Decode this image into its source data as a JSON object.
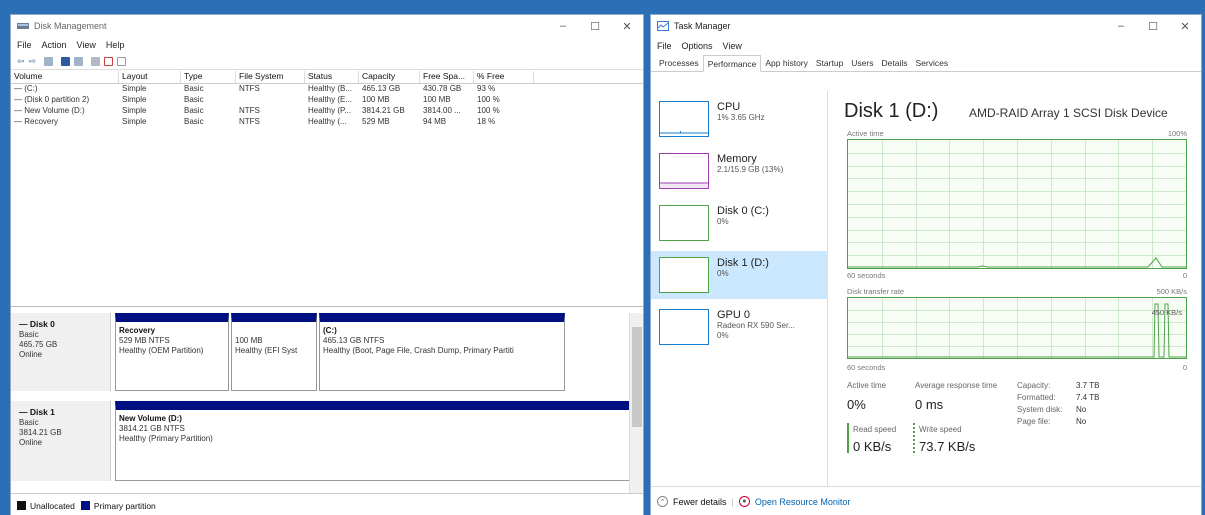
{
  "disk_management": {
    "title": "Disk Management",
    "menu": [
      "File",
      "Action",
      "View",
      "Help"
    ],
    "columns": [
      "Volume",
      "Layout",
      "Type",
      "File System",
      "Status",
      "Capacity",
      "Free Spa...",
      "% Free"
    ],
    "volumes": [
      [
        "— (C:)",
        "Simple",
        "Basic",
        "NTFS",
        "Healthy (B...",
        "465.13 GB",
        "430.78 GB",
        "93 %"
      ],
      [
        "— (Disk 0 partition 2)",
        "Simple",
        "Basic",
        "",
        "Healthy (E...",
        "100 MB",
        "100 MB",
        "100 %"
      ],
      [
        "— New Volume (D:)",
        "Simple",
        "Basic",
        "NTFS",
        "Healthy (P...",
        "3814.21 GB",
        "3814.00 ...",
        "100 %"
      ],
      [
        "— Recovery",
        "Simple",
        "Basic",
        "NTFS",
        "Healthy (...",
        "529 MB",
        "94 MB",
        "18 %"
      ]
    ],
    "disk0": {
      "name": "— Disk 0",
      "type": "Basic",
      "size": "465.75 GB",
      "status": "Online",
      "partitions": [
        {
          "title": "Recovery",
          "line1": "529 MB NTFS",
          "line2": "Healthy (OEM Partition)"
        },
        {
          "title": "",
          "line1": "100 MB",
          "line2": "Healthy (EFI Syst"
        },
        {
          "title": "(C:)",
          "line1": "465.13 GB NTFS",
          "line2": "Healthy (Boot, Page File, Crash Dump, Primary Partiti"
        }
      ]
    },
    "disk1": {
      "name": "— Disk 1",
      "type": "Basic",
      "size": "3814.21 GB",
      "status": "Online",
      "partitions": [
        {
          "title": "New Volume (D:)",
          "line1": "3814.21 GB NTFS",
          "line2": "Healthy (Primary Partition)"
        }
      ]
    },
    "legend": [
      "Unallocated",
      "Primary partition"
    ],
    "colors": {
      "unallocated": "#111111",
      "primary": "#001080"
    }
  },
  "task_manager": {
    "title": "Task Manager",
    "menu": [
      "File",
      "Options",
      "View"
    ],
    "tabs": [
      "Processes",
      "Performance",
      "App history",
      "Startup",
      "Users",
      "Details",
      "Services"
    ],
    "active_tab": "Performance",
    "sidebar": [
      {
        "name": "CPU",
        "sub1": "1% 3.65 GHz",
        "sub2": ""
      },
      {
        "name": "Memory",
        "sub1": "2.1/15.9 GB (13%)",
        "sub2": ""
      },
      {
        "name": "Disk 0 (C:)",
        "sub1": "0%",
        "sub2": ""
      },
      {
        "name": "Disk 1 (D:)",
        "sub1": "0%",
        "sub2": ""
      },
      {
        "name": "GPU 0",
        "sub1": "Radeon RX 590 Ser...",
        "sub2": "0%"
      }
    ],
    "detail": {
      "title": "Disk 1 (D:)",
      "device": "AMD-RAID Array 1  SCSI Disk Device",
      "active_time_label": "Active time",
      "active_max": "100%",
      "seconds_label": "60 seconds",
      "zero": "0",
      "transfer_label": "Disk transfer rate",
      "transfer_max": "500 KB/s",
      "transfer_mid": "450 KB/s",
      "stats": {
        "active_time": {
          "label": "Active time",
          "value": "0%"
        },
        "response": {
          "label": "Average response time",
          "value": "0 ms"
        },
        "read": {
          "label": "Read speed",
          "value": "0 KB/s"
        },
        "write": {
          "label": "Write speed",
          "value": "73.7 KB/s"
        }
      },
      "props": [
        {
          "k": "Capacity:",
          "v": "3.7 TB"
        },
        {
          "k": "Formatted:",
          "v": "7.4 TB"
        },
        {
          "k": "System disk:",
          "v": "No"
        },
        {
          "k": "Page file:",
          "v": "No"
        }
      ]
    },
    "footer": {
      "fewer": "Fewer details",
      "monitor": "Open Resource Monitor"
    },
    "colors": {
      "disk_green": "#4da34a",
      "cpu_blue": "#1a7fd0",
      "mem_purple": "#9d3fb0"
    }
  }
}
